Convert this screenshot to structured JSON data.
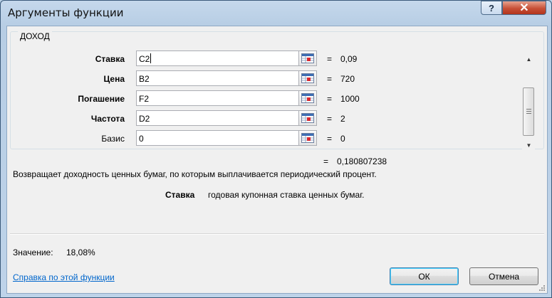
{
  "window": {
    "title": "Аргументы функции",
    "help_label": "?",
    "close_label": "✕"
  },
  "group": {
    "title": "ДОХОД"
  },
  "arguments": [
    {
      "label": "Ставка",
      "value": "C2",
      "result": "0,09",
      "bold": true
    },
    {
      "label": "Цена",
      "value": "B2",
      "result": "720",
      "bold": true
    },
    {
      "label": "Погашение",
      "value": "F2",
      "result": "1000",
      "bold": true
    },
    {
      "label": "Частота",
      "value": "D2",
      "result": "2",
      "bold": true
    },
    {
      "label": "Базис",
      "value": "0",
      "result": "0",
      "bold": false
    }
  ],
  "equals_sign": "=",
  "formula_result": "0,180807238",
  "function_description": "Возвращает доходность ценных бумаг, по которым выплачивается периодический процент.",
  "current_argument": {
    "name": "Ставка",
    "description": "годовая купонная ставка ценных бумаг."
  },
  "value_label": "Значение:",
  "value": "18,08%",
  "help_link": "Справка по этой функции",
  "buttons": {
    "ok": "ОК",
    "cancel": "Отмена"
  },
  "icons": {
    "range_select": "range-select-icon",
    "scroll_up": "scroll-up-arrow-icon",
    "scroll_down": "scroll-down-arrow-icon"
  }
}
